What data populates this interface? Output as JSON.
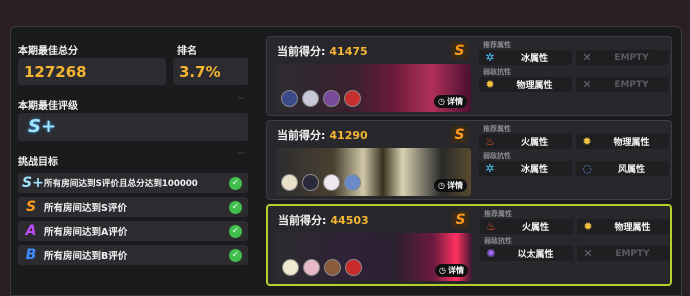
{
  "left": {
    "best_total_label": "本期最佳总分",
    "best_total_value": "127268",
    "rank_label": "排名",
    "rank_value": "3.7%",
    "best_rating_label": "本期最佳评级",
    "best_rating_value": "S+",
    "goals_label": "挑战目标",
    "goals": [
      {
        "badge": "S+",
        "badge_color": "#9fe4ff",
        "text": "所有房间达到S评价且总分达到100000"
      },
      {
        "badge": "S",
        "badge_color": "#ff9a1c",
        "text": "所有房间达到S评价"
      },
      {
        "badge": "A",
        "badge_color": "#c04cff",
        "text": "所有房间达到A评价"
      },
      {
        "badge": "B",
        "badge_color": "#3b8cff",
        "text": "所有房间达到B评价"
      }
    ]
  },
  "cards": [
    {
      "score_label": "当前得分:",
      "score": "41475",
      "rating": "S",
      "detail": "详情",
      "recommended_label": "推荐属性",
      "resist_label": "弱敌抗性",
      "recommended": [
        {
          "icon": "snowflake-icon",
          "text": "冰属性",
          "color": "#4ec8ff"
        },
        {
          "icon": "x-icon",
          "text": "EMPTY",
          "color": "#6a6a70",
          "empty": true
        }
      ],
      "resist": [
        {
          "icon": "sun-icon",
          "text": "物理属性",
          "color": "#f5c542"
        },
        {
          "icon": "x-icon",
          "text": "EMPTY",
          "color": "#6a6a70",
          "empty": true
        }
      ]
    },
    {
      "score_label": "当前得分:",
      "score": "41290",
      "rating": "S",
      "detail": "详情",
      "recommended_label": "推荐属性",
      "resist_label": "弱敌抗性",
      "recommended": [
        {
          "icon": "fire-icon",
          "text": "火属性",
          "color": "#ff5a2a"
        },
        {
          "icon": "sun-icon",
          "text": "物理属性",
          "color": "#f5c542"
        }
      ],
      "resist": [
        {
          "icon": "snowflake-icon",
          "text": "冰属性",
          "color": "#4ec8ff"
        },
        {
          "icon": "wind-icon",
          "text": "风属性",
          "color": "#6aa8ff"
        }
      ]
    },
    {
      "score_label": "当前得分:",
      "score": "44503",
      "rating": "S",
      "detail": "详情",
      "recommended_label": "推荐属性",
      "resist_label": "弱敌抗性",
      "recommended": [
        {
          "icon": "fire-icon",
          "text": "火属性",
          "color": "#ff5a2a"
        },
        {
          "icon": "sun-icon",
          "text": "物理属性",
          "color": "#f5c542"
        }
      ],
      "resist": [
        {
          "icon": "ether-icon",
          "text": "以太属性",
          "color": "#a66bff"
        },
        {
          "icon": "x-icon",
          "text": "EMPTY",
          "color": "#6a6a70",
          "empty": true
        }
      ]
    }
  ]
}
